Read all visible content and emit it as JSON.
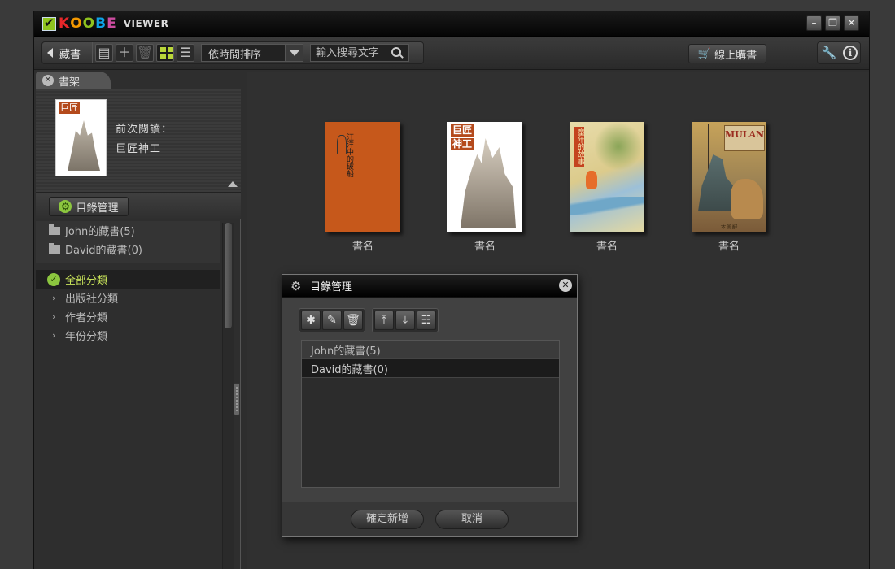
{
  "app": {
    "logo_letters": [
      {
        "char": "K",
        "color": "#e8272a"
      },
      {
        "char": "O",
        "color": "#f39800"
      },
      {
        "char": "O",
        "color": "#8fc31f"
      },
      {
        "char": "B",
        "color": "#0ea2e7"
      },
      {
        "char": "E",
        "color": "#cc4ca0"
      }
    ],
    "logo_suffix": "VIEWER",
    "window_buttons": {
      "minimize": "–",
      "restore": "❐",
      "close": "✕"
    }
  },
  "toolbar": {
    "back_label": "藏書",
    "sort_value": "依時間排序",
    "search_placeholder": "輸入搜尋文字",
    "shop_label": "線上購書",
    "tool_icon": "🔧",
    "info_icon": "i"
  },
  "sidebar": {
    "tab_label": "書架",
    "recent_label": "前次閱讀：",
    "recent_book": "巨匠神工",
    "recent_cover_title": "巨匠",
    "category_mgmt_label": "目錄管理",
    "folders": [
      {
        "label": "John的藏書(5)"
      },
      {
        "label": "David的藏書(0)"
      }
    ],
    "categories": [
      {
        "label": "全部分類",
        "active": true
      },
      {
        "label": "出版社分類",
        "active": false
      },
      {
        "label": "作者分類",
        "active": false
      },
      {
        "label": "年份分類",
        "active": false
      }
    ]
  },
  "books": [
    {
      "name": "書名",
      "cover": "orange",
      "cover_text": "汪洋中的破船"
    },
    {
      "name": "書名",
      "cover": "tower",
      "cover_text": "巨匠",
      "cover_text2": "神工"
    },
    {
      "name": "書名",
      "cover": "painting",
      "cover_text": "童年的故事"
    },
    {
      "name": "書名",
      "cover": "mulan",
      "cover_text": "MULAN",
      "cover_sub": "木蘭辭"
    }
  ],
  "dialog": {
    "title": "目錄管理",
    "close_icon": "✕",
    "tools": [
      "new-folder-icon",
      "edit-icon",
      "trash-icon",
      "move-up-icon",
      "move-down-icon",
      "sort-list-icon"
    ],
    "items": [
      {
        "label": "John的藏書(5)"
      },
      {
        "label": "David的藏書(0)"
      }
    ],
    "confirm_label": "確定新增",
    "cancel_label": "取消"
  }
}
